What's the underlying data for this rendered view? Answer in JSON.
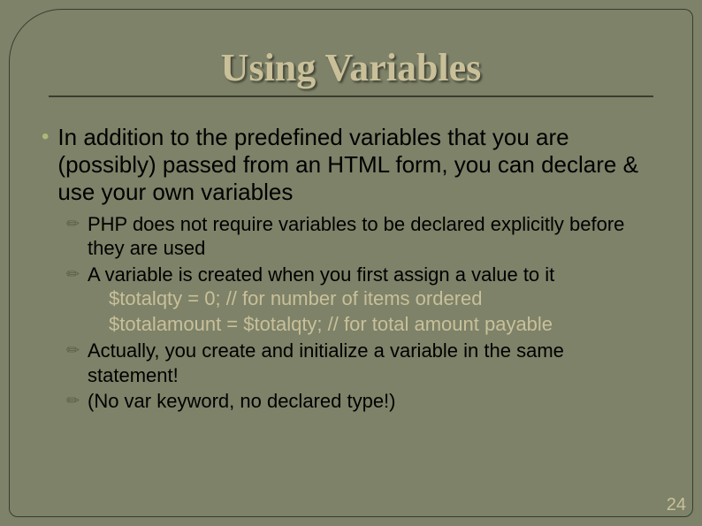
{
  "title": "Using Variables",
  "bullet": "In addition to the predefined variables that you are (possibly) passed from an HTML form, you can declare & use your own variables",
  "subs": {
    "a": "PHP does not require variables to be declared explicitly before they are used",
    "b": "A variable is created when you first assign a value to it",
    "code1": "$totalqty = 0; // for number of items ordered",
    "code2": "$totalamount = $totalqty; // for total amount payable",
    "c": "Actually, you create and initialize a variable in the same statement!",
    "d": "(No var keyword, no declared type!)"
  },
  "page": "24"
}
